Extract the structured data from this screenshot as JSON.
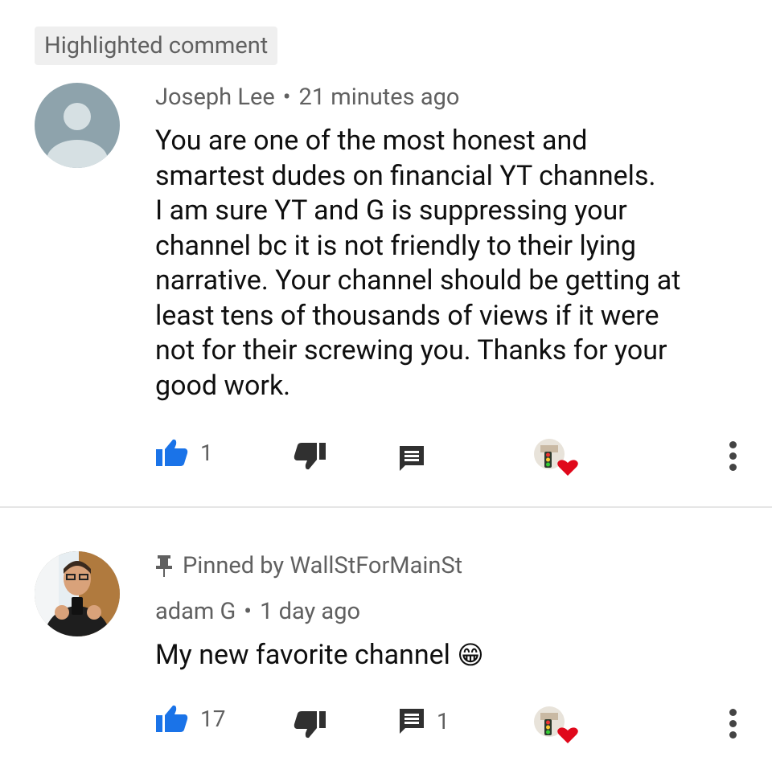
{
  "highlighted_label": "Highlighted comment",
  "comments": [
    {
      "author": "Joseph Lee",
      "separator": "•",
      "time": "21 minutes ago",
      "text": "You are one of the most honest and\nsmartest dudes on financial YT channels.\nI am sure YT and G is suppressing your\nchannel bc it is not friendly to their lying\nnarrative.  Your channel should be getting at\nleast tens of thousands of views if it were\nnot for their screwing you.  Thanks for your\ngood work.",
      "likes": "1",
      "replies": "",
      "avatar_icon": "default-person-avatar"
    },
    {
      "pinned_label": "Pinned by WallStForMainSt",
      "author": "adam G",
      "separator": "•",
      "time": "1 day ago",
      "text": "My new favorite channel",
      "emoji": "😁",
      "likes": "17",
      "replies": "1",
      "avatar_icon": "user-photo-avatar"
    }
  ],
  "icons": {
    "like": "thumbs-up-icon",
    "dislike": "thumbs-down-icon",
    "reply": "comment-icon",
    "creator_heart": "creator-heart-icon",
    "more": "more-vert-icon",
    "pin": "pin-icon"
  },
  "colors": {
    "like_blue": "#1a73e8",
    "heart_red": "#e0081b",
    "meta_grey": "#606060",
    "avatar_grey": "#8ea3ac"
  }
}
